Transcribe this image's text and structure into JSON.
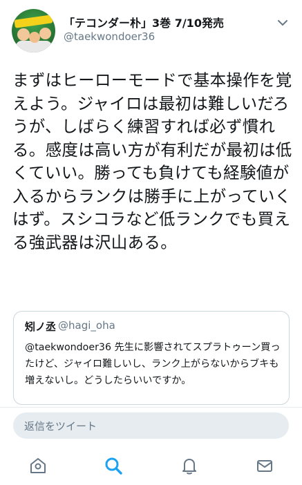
{
  "tweet": {
    "display_name": "「テコンダー朴」3巻 7/10発売",
    "handle": "@taekwondoer36",
    "text": "まずはヒーローモードで基本操作を覚えよう。ジャイロは最初は難しいだろうが、しばらく練習すれば必ず慣れる。感度は高い方が有利だが最初は低くていい。勝っても負けても経験値が入るからランクは勝手に上がっていくはず。スシコラなど低ランクでも買える強武器は沢山ある。"
  },
  "quote": {
    "name": "矧ノ丞",
    "handle": "@hagi_oha",
    "text": "@taekwondoer36 先生に影響されてスプラトゥーン買ったけど、ジャイロ難しいし、ランク上がらないからブキも増えないし。どうしたらいいですか。"
  },
  "reply": {
    "placeholder": "返信をツイート"
  },
  "tabs": {
    "home": "home-icon",
    "search": "search-icon",
    "notifications": "bell-icon",
    "messages": "mail-icon",
    "active_color": "#1da1f2",
    "inactive_color": "#657786"
  }
}
